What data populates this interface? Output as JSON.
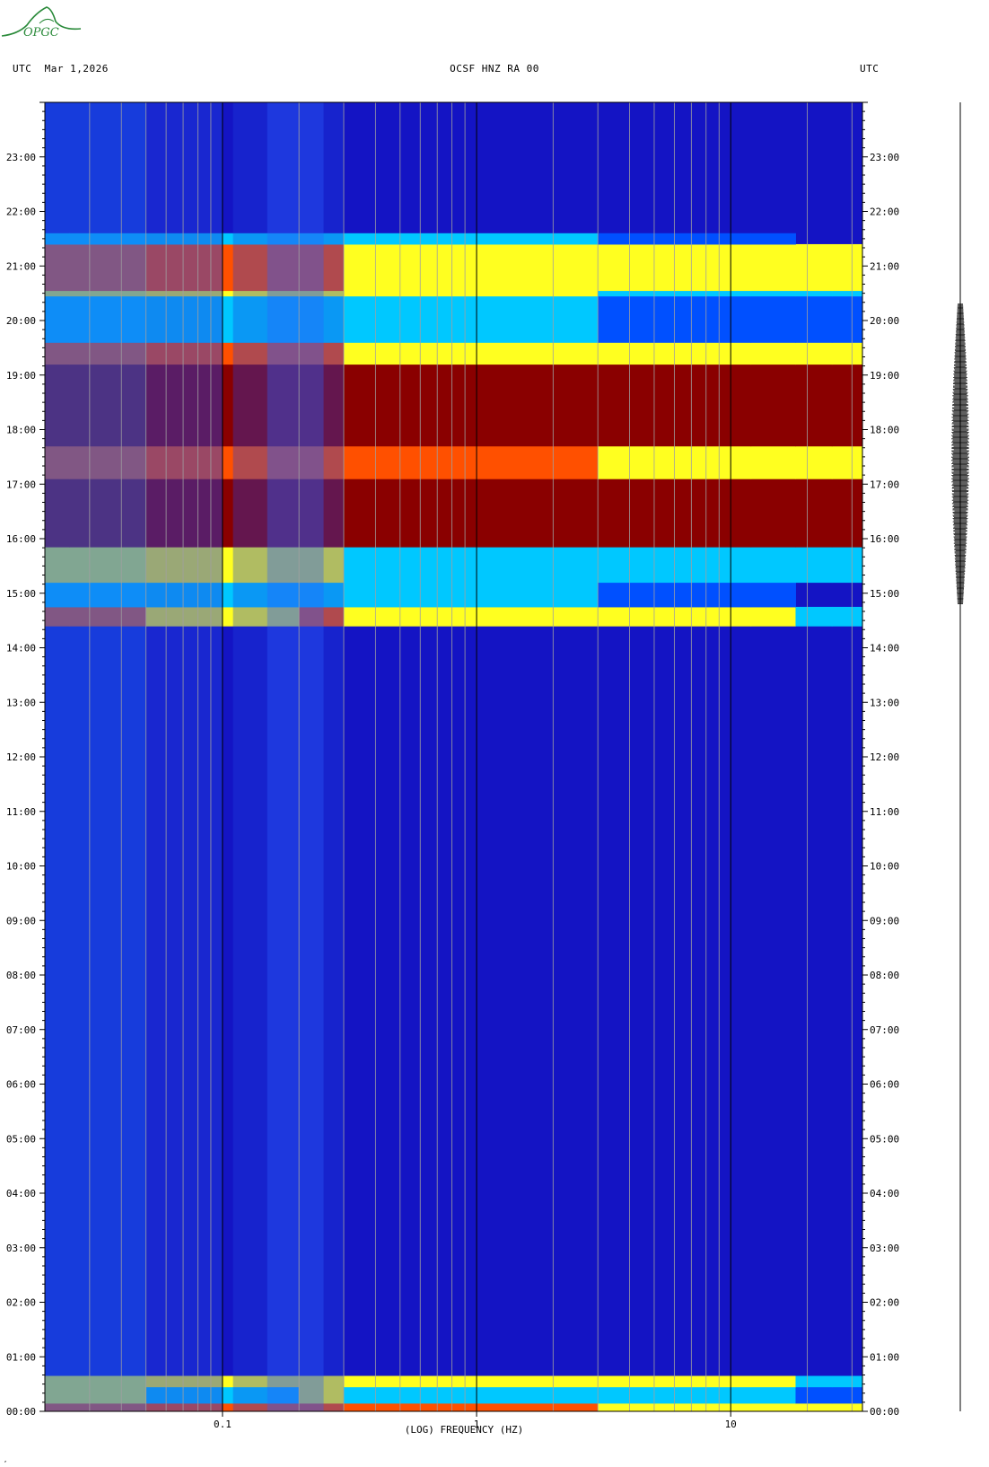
{
  "header": {
    "left": "UTC  Mar 1,2026",
    "center": "OCSF HNZ RA 00",
    "right": "UTC"
  },
  "logo": {
    "text": "OPGC",
    "color": "#2a8a3a"
  },
  "chart_data": {
    "type": "heatmap",
    "title": "OCSF HNZ RA 00",
    "xlabel": "(LOG) FREQUENCY (HZ)",
    "xscale": "log",
    "xlim": [
      0.02,
      33
    ],
    "x_tick_labels": [
      {
        "value": 0.1,
        "label": "0.1"
      },
      {
        "value": 1,
        "label": "1"
      },
      {
        "value": 10,
        "label": "10"
      }
    ],
    "y_tick_labels": [
      "00:00",
      "01:00",
      "02:00",
      "03:00",
      "04:00",
      "05:00",
      "06:00",
      "07:00",
      "08:00",
      "09:00",
      "10:00",
      "11:00",
      "12:00",
      "13:00",
      "14:00",
      "15:00",
      "16:00",
      "17:00",
      "18:00",
      "19:00",
      "20:00",
      "21:00",
      "22:00",
      "23:00"
    ],
    "ylim": [
      0,
      24
    ],
    "colormap": [
      "#1010c0",
      "#0050ff",
      "#00c8ff",
      "#ffff20",
      "#ff5000",
      "#8a0000"
    ],
    "intensity_bands": [
      {
        "from": 0.0,
        "to": 0.15,
        "level": 4.5
      },
      {
        "from": 0.15,
        "to": 0.45,
        "level": 3.0
      },
      {
        "from": 0.45,
        "to": 0.65,
        "level": 3.8
      },
      {
        "from": 14.4,
        "to": 14.75,
        "level": 4.0
      },
      {
        "from": 14.75,
        "to": 15.2,
        "level": 2.6
      },
      {
        "from": 15.2,
        "to": 15.85,
        "level": 3.3
      },
      {
        "from": 15.85,
        "to": 17.1,
        "level": 5.0
      },
      {
        "from": 17.1,
        "to": 17.7,
        "level": 4.4
      },
      {
        "from": 17.7,
        "to": 19.2,
        "level": 5.0
      },
      {
        "from": 19.2,
        "to": 19.6,
        "level": 4.2
      },
      {
        "from": 19.6,
        "to": 20.45,
        "level": 2.8
      },
      {
        "from": 20.45,
        "to": 20.55,
        "level": 3.6
      },
      {
        "from": 20.55,
        "to": 21.4,
        "level": 4.2
      },
      {
        "from": 21.4,
        "to": 21.6,
        "level": 2.5
      }
    ],
    "seismogram_span": [
      14.8,
      20.3
    ]
  },
  "footer": {
    "mark": "‚"
  }
}
